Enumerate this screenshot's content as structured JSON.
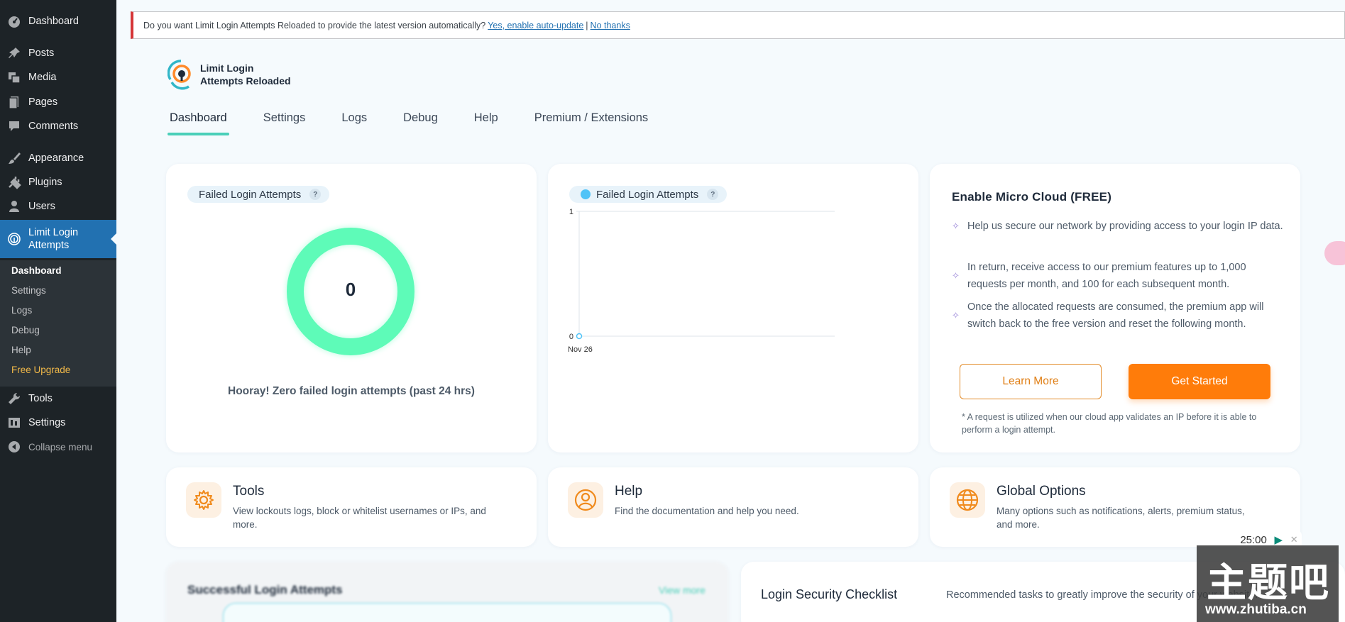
{
  "sidebar": {
    "items": [
      {
        "label": "Dashboard",
        "icon": "dashboard-icon"
      },
      {
        "label": "Posts",
        "icon": "pin-icon"
      },
      {
        "label": "Media",
        "icon": "media-icon"
      },
      {
        "label": "Pages",
        "icon": "pages-icon"
      },
      {
        "label": "Comments",
        "icon": "comment-icon"
      },
      {
        "label": "Appearance",
        "icon": "brush-icon"
      },
      {
        "label": "Plugins",
        "icon": "plug-icon"
      },
      {
        "label": "Users",
        "icon": "user-icon"
      },
      {
        "label": "Limit Login Attempts",
        "icon": "fingerprint-icon"
      },
      {
        "label": "Tools",
        "icon": "wrench-icon"
      },
      {
        "label": "Settings",
        "icon": "settings-icon"
      }
    ],
    "submenu": [
      "Dashboard",
      "Settings",
      "Logs",
      "Debug",
      "Help",
      "Free Upgrade"
    ],
    "collapse_label": "Collapse menu"
  },
  "notice": {
    "text": "Do you want Limit Login Attempts Reloaded to provide the latest version automatically?",
    "link_yes": "Yes, enable auto-update",
    "separator": "|",
    "link_no": "No thanks"
  },
  "plugin": {
    "logo_line1": "Limit Login",
    "logo_line2": "Attempts Reloaded",
    "tabs": [
      "Dashboard",
      "Settings",
      "Logs",
      "Debug",
      "Help",
      "Premium / Extensions"
    ]
  },
  "failed_card": {
    "pill": "Failed Login Attempts",
    "help": "?",
    "count": "0",
    "message": "Hooray! Zero failed login attempts (past 24 hrs)",
    "ring_color": "#5efbb8"
  },
  "chart_card": {
    "pill": "Failed Login Attempts",
    "help": "?",
    "dot_color": "#4fc3f7"
  },
  "chart_data": {
    "type": "line",
    "categories": [
      "Nov 26"
    ],
    "series": [
      {
        "values": [
          0
        ]
      }
    ],
    "ylim": [
      0,
      1
    ],
    "yticks": [
      "0",
      "1"
    ],
    "title": "",
    "xlabel": "",
    "ylabel": ""
  },
  "micro_cloud": {
    "title": "Enable Micro Cloud (FREE)",
    "items": [
      "Help us secure our network by providing access to your login IP data.",
      "In return, receive access to our premium features up to 1,000 requests per month, and 100 for each subsequent month.",
      "Once the allocated requests are consumed, the premium app will switch back to the free version and reset the following month."
    ],
    "learn_more": "Learn More",
    "get_started": "Get Started",
    "note": "* A request is utilized when our cloud app validates an IP before it is able to perform a login attempt."
  },
  "features": [
    {
      "title": "Tools",
      "desc": "View lockouts logs, block or whitelist usernames or IPs, and more.",
      "icon": "gear-icon"
    },
    {
      "title": "Help",
      "desc": "Find the documentation and help you need.",
      "icon": "support-icon"
    },
    {
      "title": "Global Options",
      "desc": "Many options such as notifications, alerts, premium status, and more.",
      "icon": "globe-icon"
    }
  ],
  "successful_card": {
    "title": "Successful Login Attempts",
    "link": "View more"
  },
  "checklist": {
    "title": "Login Security Checklist",
    "desc": "Recommended tasks to greatly improve the security of your website."
  },
  "timer": {
    "value": "25:00"
  },
  "watermark": {
    "big": "主题吧",
    "url": "www.zhutiba.cn"
  }
}
